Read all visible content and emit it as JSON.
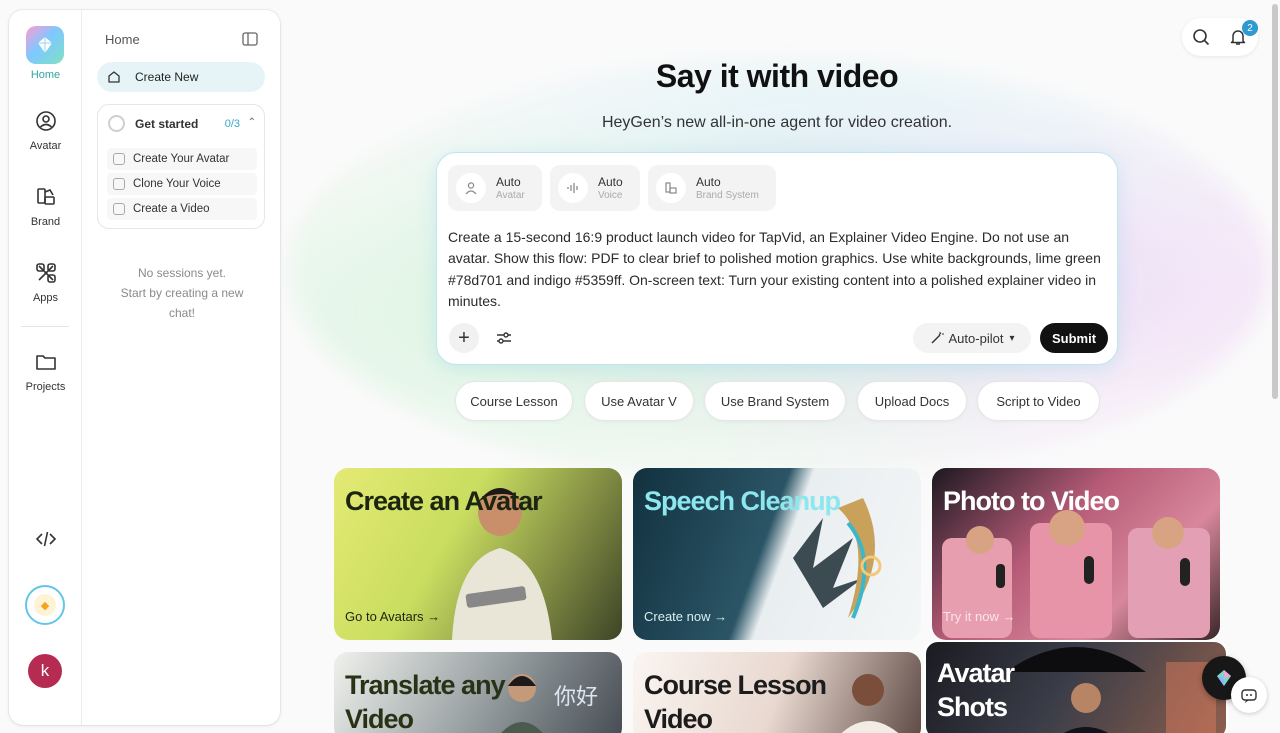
{
  "rail": {
    "items": [
      {
        "label": "Home",
        "icon": "home-logo-icon"
      },
      {
        "label": "Avatar",
        "icon": "avatar-icon"
      },
      {
        "label": "Brand",
        "icon": "brand-icon"
      },
      {
        "label": "Apps",
        "icon": "apps-icon"
      },
      {
        "label": "Projects",
        "icon": "folder-icon"
      }
    ],
    "user_initial": "k"
  },
  "panel": {
    "title": "Home",
    "create_new": "Create New",
    "get_started": {
      "title": "Get started",
      "progress": "0/3",
      "tasks": [
        "Create Your Avatar",
        "Clone Your Voice",
        "Create a Video"
      ]
    },
    "empty_line1": "No sessions yet.",
    "empty_line2": "Start by creating a new chat!"
  },
  "header": {
    "notification_count": "2"
  },
  "main": {
    "headline": "Say it with video",
    "subhead": "HeyGen’s new all-in-one agent for video creation.",
    "composer": {
      "chips": [
        {
          "value": "Auto",
          "label": "Avatar"
        },
        {
          "value": "Auto",
          "label": "Voice"
        },
        {
          "value": "Auto",
          "label": "Brand System"
        }
      ],
      "prompt": "Create a 15-second 16:9 product launch video for TapVid, an Explainer Video Engine. Do not use an avatar. Show this flow: PDF to clear brief to polished motion graphics. Use white backgrounds, lime green #78d701 and indigo #5359ff. On-screen text: Turn your existing content into a polished explainer video in minutes.",
      "mode": "Auto-pilot",
      "submit": "Submit"
    },
    "quick_actions": [
      "Course Lesson",
      "Use Avatar V",
      "Use Brand System",
      "Upload Docs",
      "Script to Video"
    ],
    "cards": [
      {
        "title": "Create an Avatar",
        "link": "Go to Avatars →"
      },
      {
        "title": "Speech Cleanup",
        "link": "Create now →"
      },
      {
        "title": "Photo to Video",
        "link": "Try it now →"
      },
      {
        "title": "Translate any Video",
        "link": ""
      },
      {
        "title": "Course Lesson Video",
        "link": ""
      },
      {
        "title": "Avatar Shots",
        "link": ""
      }
    ]
  },
  "colors": {
    "accent": "#2fa6a0",
    "submit": "#111111",
    "badge": "#2e9ad0",
    "user": "#b52b52"
  }
}
